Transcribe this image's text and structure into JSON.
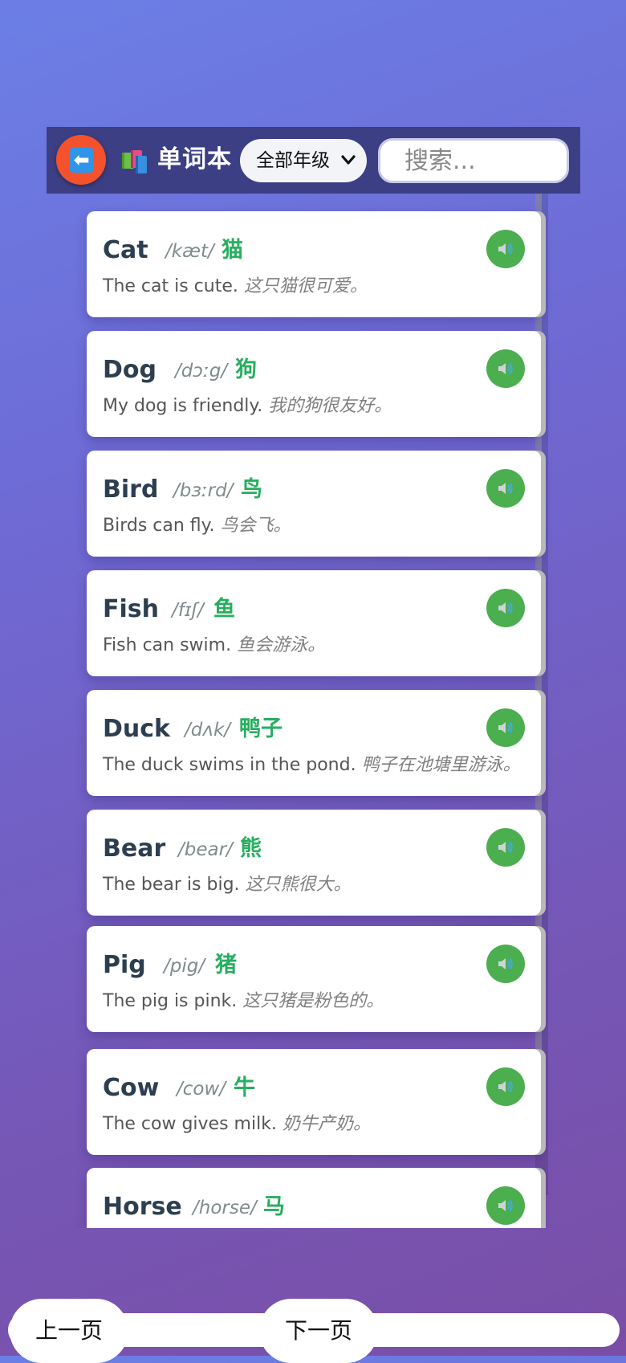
{
  "header": {
    "title": "单词本",
    "grade_select": {
      "selected": "全部年级"
    },
    "search": {
      "placeholder": "搜索..."
    }
  },
  "words": [
    {
      "word": "Cat",
      "phonetic": "/kæt/",
      "meaning": "猫",
      "example": "The cat is cute.",
      "example_cn": "这只猫很可爱。"
    },
    {
      "word": "Dog",
      "phonetic": "/dɔːg/",
      "meaning": "狗",
      "example": "My dog is friendly.",
      "example_cn": "我的狗很友好。"
    },
    {
      "word": "Bird",
      "phonetic": "/bɜːrd/",
      "meaning": "鸟",
      "example": "Birds can fly.",
      "example_cn": "鸟会飞。"
    },
    {
      "word": "Fish",
      "phonetic": "/fɪʃ/",
      "meaning": "鱼",
      "example": "Fish can swim.",
      "example_cn": "鱼会游泳。"
    },
    {
      "word": "Duck",
      "phonetic": "/dʌk/",
      "meaning": "鸭子",
      "example": "The duck swims in the pond.",
      "example_cn": "鸭子在池塘里游泳。"
    },
    {
      "word": "Bear",
      "phonetic": "/bear/",
      "meaning": "熊",
      "example": "The bear is big.",
      "example_cn": "这只熊很大。"
    },
    {
      "word": "Pig",
      "phonetic": "/pig/",
      "meaning": "猪",
      "example": "The pig is pink.",
      "example_cn": "这只猪是粉色的。"
    },
    {
      "word": "Cow",
      "phonetic": "/cow/",
      "meaning": "牛",
      "example": "The cow gives milk.",
      "example_cn": "奶牛产奶。"
    },
    {
      "word": "Horse",
      "phonetic": "/horse/",
      "meaning": "马",
      "example": "",
      "example_cn": ""
    }
  ],
  "pagination": {
    "prev_label": "上一页",
    "next_label": "下一页"
  },
  "colors": {
    "back_button": "#f4522d",
    "audio_button": "#4bae4f",
    "meaning_text": "#27ae60",
    "header_bar": "#3d3f85"
  }
}
